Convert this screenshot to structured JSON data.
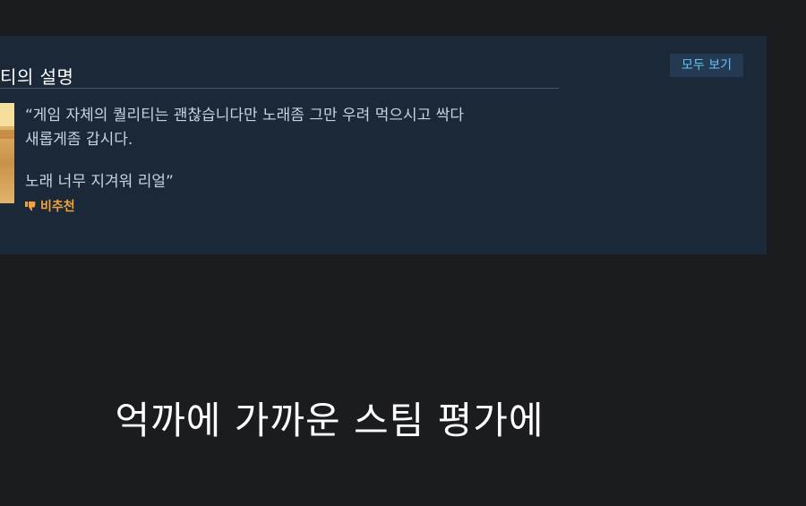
{
  "panel": {
    "title": "티의 설명",
    "view_all_label": "모두 보기",
    "review": {
      "line1": "“게임 자체의 퀄리티는 괜찮습니다만 노래좀 그만 우려 먹으시고 싹다",
      "line2": "새롭게좀 갑시다.",
      "line3": "노래 너무 지겨워 리얼”",
      "verdict_label": "비추천",
      "verdict_icon": "thumbs-down-icon",
      "verdict_color": "#f2a23b"
    }
  },
  "caption": {
    "text": "억까에 가까운 스팀 평가에"
  }
}
